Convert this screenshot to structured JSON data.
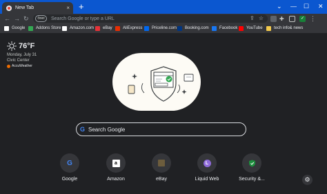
{
  "tab": {
    "title": "New Tab",
    "close": "×",
    "favicon": "chrome-icon"
  },
  "window": {
    "new_tab": "+",
    "dropdown": "⌄",
    "minimize": "—",
    "maximize": "☐",
    "close": "✕"
  },
  "toolbar": {
    "back": "←",
    "forward": "→",
    "reload": "↻",
    "omnibox_badge": "वेबसा",
    "omnibox_placeholder": "Search Google or type a URL",
    "share": "⇪",
    "star": "☆",
    "profile": "✓",
    "menu": "⋮",
    "puzzle": "✚"
  },
  "bookmarks": [
    {
      "label": "Google",
      "color": "#ffffff"
    },
    {
      "label": "Addons Store",
      "color": "#34a853"
    },
    {
      "label": "Amazon.com",
      "color": "#ffffff"
    },
    {
      "label": "eBay",
      "color": "#e53238"
    },
    {
      "label": "AliExpress",
      "color": "#e62e04"
    },
    {
      "label": "Priceline.com",
      "color": "#0068ef"
    },
    {
      "label": "Booking.com",
      "color": "#003580"
    },
    {
      "label": "Facebook",
      "color": "#1877f2"
    },
    {
      "label": "YouTube",
      "color": "#ff0000"
    },
    {
      "label": "tech info& news",
      "color": "#f2c94c"
    }
  ],
  "weather": {
    "temperature": "76°F",
    "date": "Monday, July 31",
    "location": "Civic Center",
    "provider": "AccuWeather",
    "icon": "sun-icon"
  },
  "search": {
    "placeholder": "Search Google",
    "icon": "google-g-icon"
  },
  "shortcuts": [
    {
      "label": "Google",
      "icon": "google-icon",
      "glyph": "G"
    },
    {
      "label": "Amazon",
      "icon": "amazon-icon",
      "glyph": "a"
    },
    {
      "label": "eBay",
      "icon": "ebay-icon",
      "glyph": ""
    },
    {
      "label": "Liquid Web",
      "icon": "liquid-web-icon",
      "glyph": "L"
    },
    {
      "label": "Security &...",
      "icon": "security-shield-icon",
      "glyph": ""
    }
  ],
  "customize": {
    "icon": "gear-icon",
    "glyph": "⚙"
  },
  "colors": {
    "titlebar": "#0b57d0",
    "background": "#202124",
    "toolbar": "#35363a",
    "illustration_bg": "#fdfbf5"
  }
}
